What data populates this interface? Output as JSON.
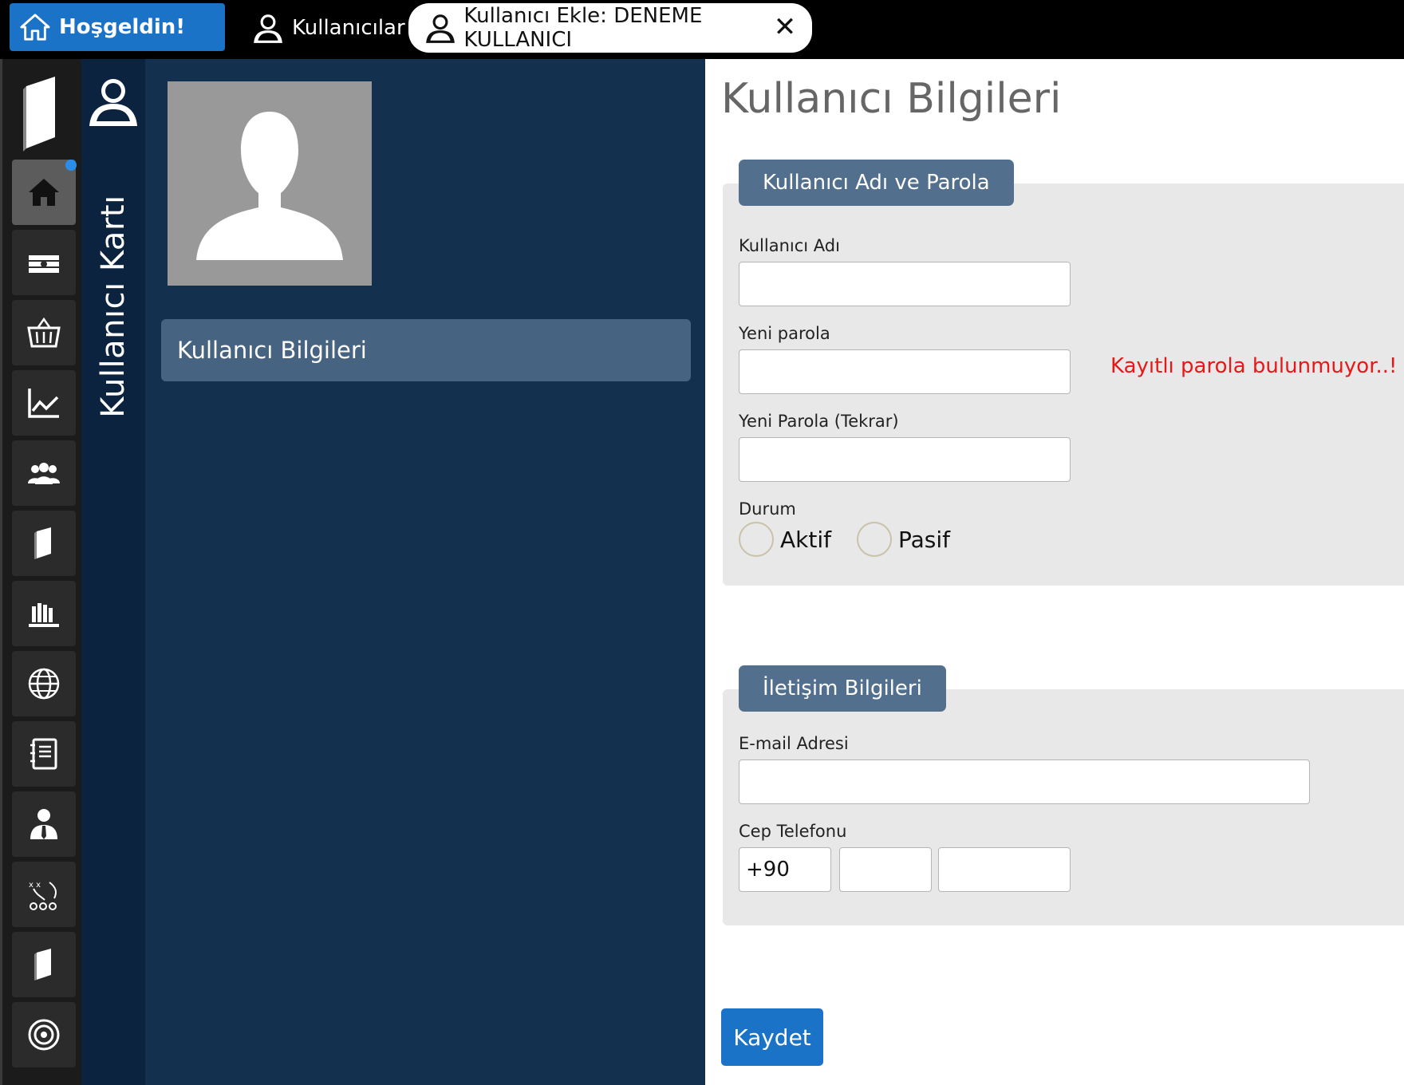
{
  "tabs": {
    "home": "Hoşgeldin!",
    "users": "Kullanıcılar",
    "add": "Kullanıcı Ekle: DENEME KULLANICI"
  },
  "strip": {
    "title": "Kullanıcı Kartı"
  },
  "side": {
    "menu_item": "Kullanıcı Bilgileri"
  },
  "main": {
    "title": "Kullanıcı Bilgileri",
    "section1": {
      "tab": "Kullanıcı Adı ve Parola",
      "username_label": "Kullanıcı Adı",
      "username_value": "",
      "new_password_label": "Yeni parola",
      "new_password_value": "",
      "password_warning": "Kayıtlı parola bulunmuyor..!",
      "repeat_password_label": "Yeni Parola (Tekrar)",
      "repeat_password_value": "",
      "status_label": "Durum",
      "status_active": "Aktif",
      "status_passive": "Pasif"
    },
    "section2": {
      "tab": "İletişim Bilgileri",
      "email_label": "E-mail Adresi",
      "email_value": "",
      "phone_label": "Cep Telefonu",
      "phone_country": "+90",
      "phone_area": "",
      "phone_number": ""
    },
    "save_label": "Kaydet"
  },
  "icons": {
    "sidebar": [
      "home-icon",
      "money-icon",
      "basket-icon",
      "chart-line-icon",
      "group-icon",
      "book-icon",
      "library-icon",
      "globe-icon",
      "notebook-icon",
      "person-tie-icon",
      "strategy-icon",
      "book-icon-2",
      "target-icon"
    ]
  },
  "colors": {
    "accent": "#1a73c7",
    "side_panel": "#13304e",
    "section_tab": "#52708e",
    "warning": "#e81818"
  }
}
